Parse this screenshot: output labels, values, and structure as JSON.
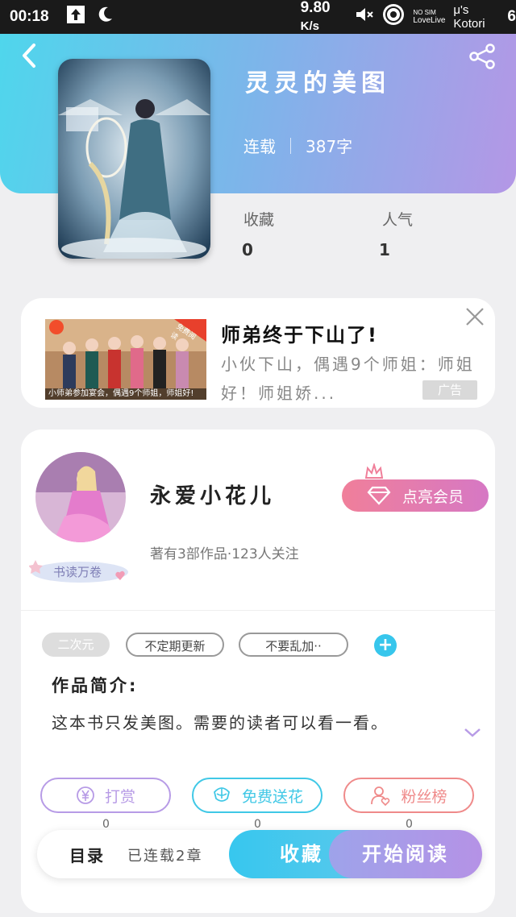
{
  "status_bar": {
    "time": "00:18",
    "speed": "9.80",
    "speed_unit": "K/s",
    "sim": "NO SIM",
    "sim_sub": "LoveLive",
    "carrier": "μ's Kotori",
    "battery": "6"
  },
  "book": {
    "title": "灵灵的美图",
    "status": "连载",
    "word_count": "387字",
    "stats": [
      {
        "label": "收藏",
        "value": "0"
      },
      {
        "label": "人气",
        "value": "1"
      }
    ]
  },
  "ad": {
    "title": "师弟终于下山了!",
    "desc": "小伙下山，偶遇9个师姐：师姐好！师姐娇...",
    "badge": "广告",
    "image_caption": "小师弟参加宴会，偶遇9个师姐，师姐好!",
    "image_corner": "免费阅读"
  },
  "author": {
    "name": "永爱小花儿",
    "meta": "著有3部作品·123人关注",
    "badge": "书读万卷",
    "vip_label": "点亮会员"
  },
  "tags": [
    "二次元",
    "不定期更新",
    "不要乱加··"
  ],
  "intro": {
    "heading": "作品简介:",
    "text": "这本书只发美图。需要的读者可以看一看。"
  },
  "actions": [
    {
      "label": "打赏",
      "count": "0",
      "color": "#b79be6"
    },
    {
      "label": "免费送花",
      "count": "0",
      "color": "#40c8e6"
    },
    {
      "label": "粉丝榜",
      "count": "0",
      "color": "#ef8a8a"
    }
  ],
  "bottom": {
    "toc": "目录",
    "chapters": "已连载2章",
    "favorite": "收藏",
    "read": "开始阅读"
  },
  "icons": [
    "back-icon",
    "share-icon",
    "close-icon",
    "diamond-icon",
    "crown-icon",
    "plus-icon",
    "chevron-down-icon",
    "yen-icon",
    "flower-icon",
    "fans-icon"
  ]
}
